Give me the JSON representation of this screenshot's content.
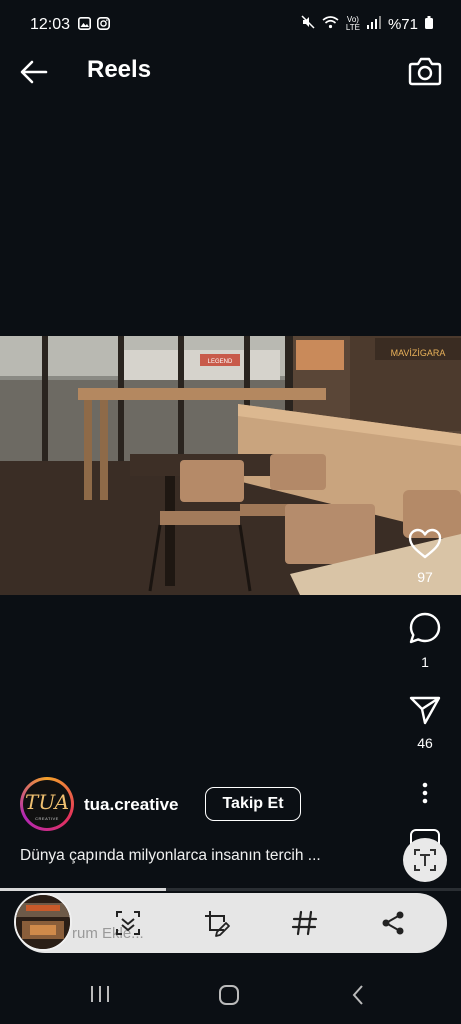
{
  "status_bar": {
    "time": "12:03",
    "left_icons": [
      "image-icon",
      "instagram-icon"
    ],
    "right_icons": [
      "mute-icon",
      "wifi-icon",
      "volte-icon",
      "signal-icon",
      "battery-icon"
    ],
    "volte_top": "Vo)",
    "volte_bottom": "LTE",
    "battery": "%71"
  },
  "header": {
    "title": "Reels",
    "back_icon": "arrow-left-icon",
    "camera_icon": "camera-icon"
  },
  "video": {
    "shelf_sign": "MAVİZİGARA",
    "store_sign": "LEGEND"
  },
  "actions": {
    "like_count": "97",
    "comment_count": "1",
    "share_count": "46"
  },
  "author": {
    "username": "tua.creative",
    "avatar_text": "TUA",
    "avatar_subtext": "CREATIVE",
    "follow_label": "Takip Et"
  },
  "caption": "Dünya çapında milyonlarca insanın tercih ...",
  "toolbar": {
    "hint_text": "rum Ekle...",
    "tools": [
      "expand-select-icon",
      "edit-crop-icon",
      "hashtag-icon",
      "share-nodes-icon"
    ],
    "progress_fraction": 0.36
  },
  "colors": {
    "background": "#0b0f14",
    "toolbar": "#e6e6e6",
    "accent_gradient": [
      "#f4a12a",
      "#e4325b",
      "#b227b5"
    ]
  },
  "nav": [
    "recent-apps-icon",
    "home-icon",
    "back-icon"
  ]
}
